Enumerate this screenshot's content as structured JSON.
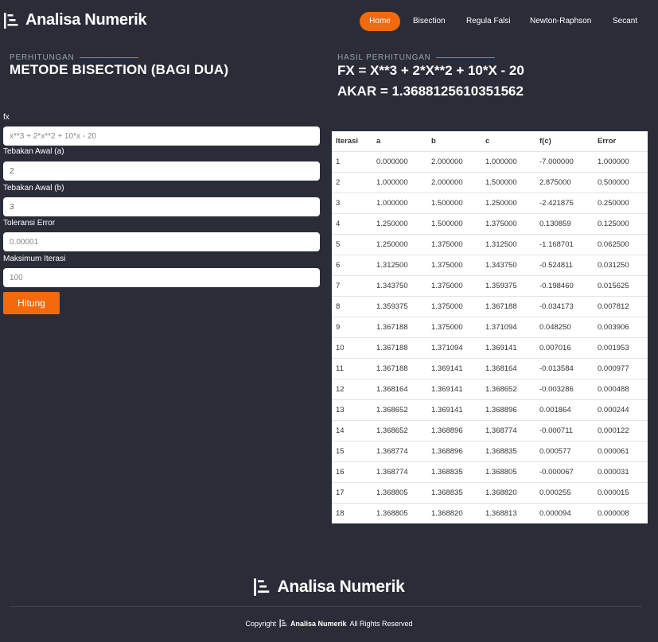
{
  "brand": {
    "name": "Analisa Numerik"
  },
  "nav": {
    "items": [
      {
        "label": "Home"
      },
      {
        "label": "Bisection"
      },
      {
        "label": "Regula Falsi"
      },
      {
        "label": "Newton-Raphson"
      },
      {
        "label": "Secant"
      }
    ]
  },
  "calc": {
    "eyebrow": "PERHITUNGAN",
    "title": "METODE BISECTION (BAGI DUA)"
  },
  "result": {
    "eyebrow": "HASIL PERHITUNGAN",
    "fx": "FX = X**3 + 2*X**2 + 10*X - 20",
    "root": "AKAR = 1.3688125610351562"
  },
  "form": {
    "fx": {
      "label": "fx",
      "placeholder": "x**3 + 2*x**2 + 10*x - 20"
    },
    "a": {
      "label": "Tebakan Awal (a)",
      "value": "2"
    },
    "b": {
      "label": "Tebakan Awal (b)",
      "value": "3"
    },
    "tol": {
      "label": "Toleransi Error",
      "placeholder": "0.00001"
    },
    "maxit": {
      "label": "Maksimum Iterasi",
      "placeholder": "100"
    },
    "submit": "Hitung"
  },
  "table": {
    "headers": [
      "Iterasi",
      "a",
      "b",
      "c",
      "f(c)",
      "Error"
    ],
    "rows": [
      [
        "1",
        "0.000000",
        "2.000000",
        "1.000000",
        "-7.000000",
        "1.000000"
      ],
      [
        "2",
        "1.000000",
        "2.000000",
        "1.500000",
        "2.875000",
        "0.500000"
      ],
      [
        "3",
        "1.000000",
        "1.500000",
        "1.250000",
        "-2.421875",
        "0.250000"
      ],
      [
        "4",
        "1.250000",
        "1.500000",
        "1.375000",
        "0.130859",
        "0.125000"
      ],
      [
        "5",
        "1.250000",
        "1.375000",
        "1.312500",
        "-1.168701",
        "0.062500"
      ],
      [
        "6",
        "1.312500",
        "1.375000",
        "1.343750",
        "-0.524811",
        "0.031250"
      ],
      [
        "7",
        "1.343750",
        "1.375000",
        "1.359375",
        "-0.198460",
        "0.015625"
      ],
      [
        "8",
        "1.359375",
        "1.375000",
        "1.367188",
        "-0.034173",
        "0.007812"
      ],
      [
        "9",
        "1.367188",
        "1.375000",
        "1.371094",
        "0.048250",
        "0.003906"
      ],
      [
        "10",
        "1.367188",
        "1.371094",
        "1.369141",
        "0.007016",
        "0.001953"
      ],
      [
        "11",
        "1.367188",
        "1.369141",
        "1.368164",
        "-0.013584",
        "0.000977"
      ],
      [
        "12",
        "1.368164",
        "1.369141",
        "1.368652",
        "-0.003286",
        "0.000488"
      ],
      [
        "13",
        "1.368652",
        "1.369141",
        "1.368896",
        "0.001864",
        "0.000244"
      ],
      [
        "14",
        "1.368652",
        "1.368896",
        "1.368774",
        "-0.000711",
        "0.000122"
      ],
      [
        "15",
        "1.368774",
        "1.368896",
        "1.368835",
        "0.000577",
        "0.000061"
      ],
      [
        "16",
        "1.368774",
        "1.368835",
        "1.368805",
        "-0.000067",
        "0.000031"
      ],
      [
        "17",
        "1.368805",
        "1.368835",
        "1.368820",
        "0.000255",
        "0.000015"
      ],
      [
        "18",
        "1.368805",
        "1.368820",
        "1.368813",
        "0.000094",
        "0.000008"
      ]
    ]
  },
  "footer": {
    "brand": "Analisa Numerik",
    "copyright_prefix": "Copyright",
    "copyright_brand": "Analisa Numerik",
    "copyright_suffix": "All Rights Reserved"
  },
  "colors": {
    "accent": "#f26a0c",
    "background": "#2a2d38"
  }
}
